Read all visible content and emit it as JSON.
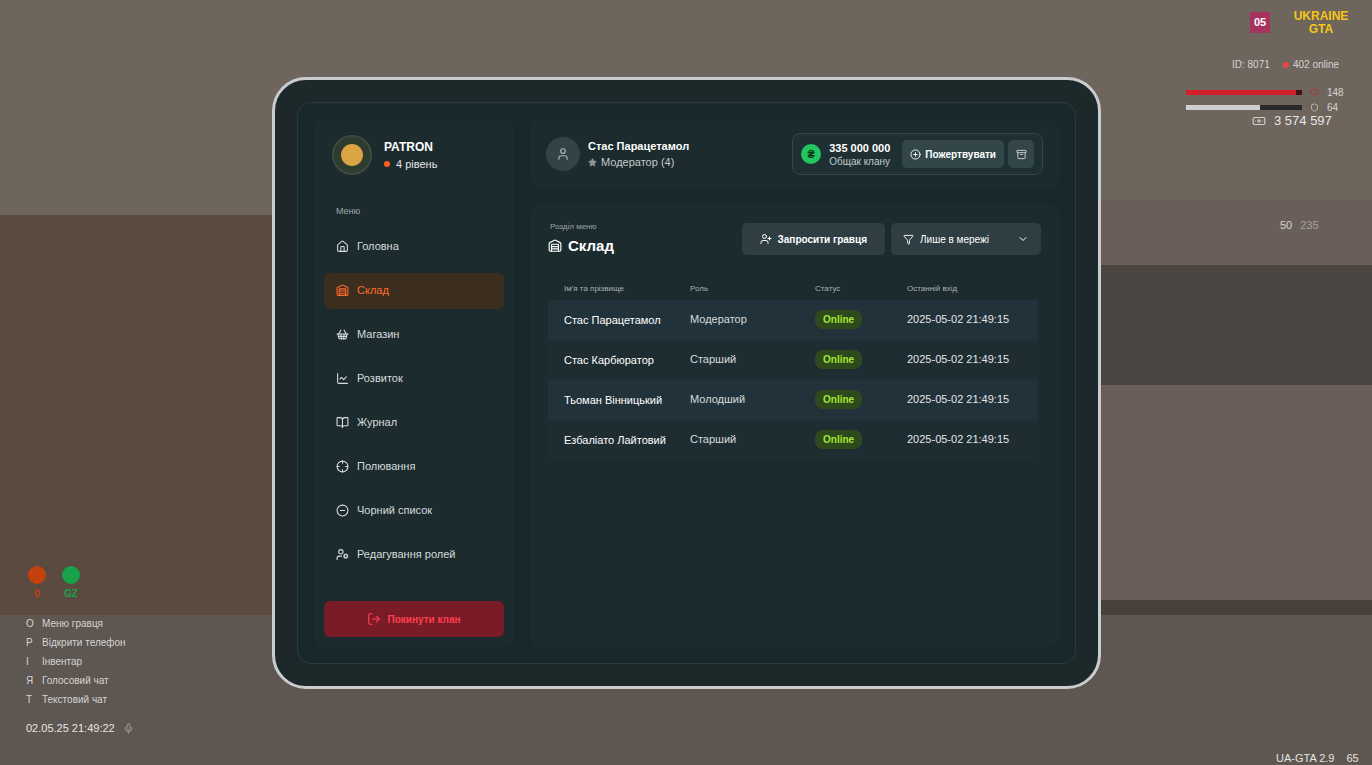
{
  "clan": {
    "name": "PATRON",
    "level": "4 рівень"
  },
  "user": {
    "name": "Стас Парацетамол",
    "role": "Модератор (4)"
  },
  "treasury": {
    "amount": "335 000 000",
    "label": "Общак клану",
    "currency": "₴",
    "donate_button": "Пожертвувати"
  },
  "sidebar": {
    "label": "Меню",
    "items": [
      {
        "label": "Головна",
        "selected": false
      },
      {
        "label": "Склад",
        "selected": true
      },
      {
        "label": "Магазин",
        "selected": false
      },
      {
        "label": "Розвиток",
        "selected": false
      },
      {
        "label": "Журнал",
        "selected": false
      },
      {
        "label": "Полювання",
        "selected": false
      },
      {
        "label": "Чорний список",
        "selected": false
      },
      {
        "label": "Редагування ролей",
        "selected": false
      }
    ],
    "leave_button": "Покинути клан"
  },
  "section": {
    "caption": "Розділ меню",
    "title": "Склад",
    "invite_button": "Запросити гравця",
    "filter": "Лише в мережі"
  },
  "table": {
    "columns": [
      "Ім'я та прізвище",
      "Роль",
      "Статус",
      "Останній вхід"
    ],
    "rows": [
      {
        "name": "Стас Парацетамол",
        "role": "Модератор",
        "status": "Online",
        "last_login": "2025-05-02 21:49:15"
      },
      {
        "name": "Стас Карбюратор",
        "role": "Старший",
        "status": "Online",
        "last_login": "2025-05-02 21:49:15"
      },
      {
        "name": "Тьоман Вінницький",
        "role": "Молодший",
        "status": "Online",
        "last_login": "2025-05-02 21:49:15"
      },
      {
        "name": "Езбаліато Лайтовий",
        "role": "Старший",
        "status": "Online",
        "last_login": "2025-05-02 21:49:15"
      }
    ]
  },
  "hud": {
    "logo": "UKRAINE GTA",
    "badge": "05",
    "player_id": "ID: 8071",
    "online": "402 online",
    "health": {
      "reading": "148",
      "level": 0.95
    },
    "armor": {
      "reading": "64",
      "level": 0.64
    },
    "money": "3 574 597",
    "ammo": "50",
    "ammo_total": "235",
    "indicators": [
      {
        "label": "0",
        "color": "#c2410c"
      },
      {
        "label": "GZ",
        "color": "#16a34a"
      }
    ],
    "hints": [
      {
        "key": "O",
        "label": "Меню гравця"
      },
      {
        "key": "P",
        "label": "Відкрити телефон"
      },
      {
        "key": "I",
        "label": "Інвентар"
      },
      {
        "key": "Я",
        "label": "Голосовий чат"
      },
      {
        "key": "T",
        "label": "Текстовий чат"
      }
    ],
    "datetime": "02.05.25 21:49:22",
    "version": "UA-GTA 2.9",
    "fps": "65"
  }
}
